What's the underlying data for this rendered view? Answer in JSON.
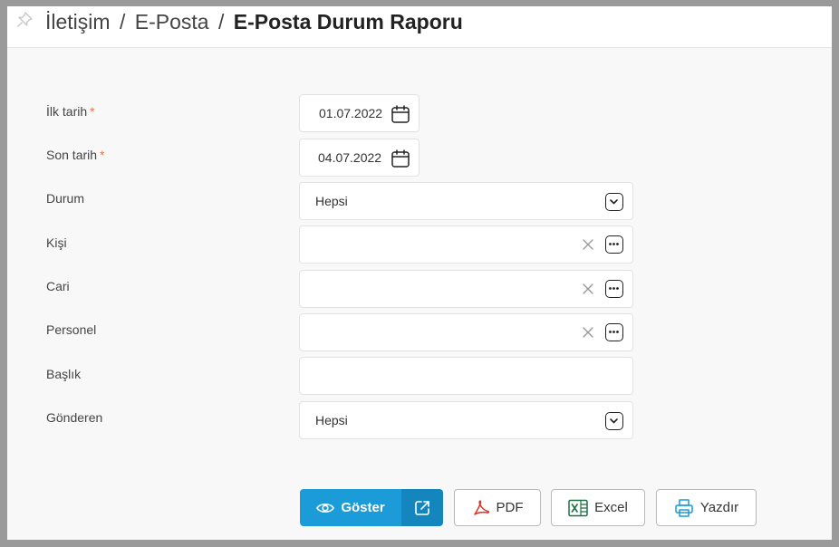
{
  "header": {
    "breadcrumb": [
      "İletişim",
      "E-Posta"
    ],
    "separator": "/",
    "title": "E-Posta Durum Raporu"
  },
  "form": {
    "required_mark": "*",
    "start_date": {
      "label": "İlk tarih",
      "value": "01.07.2022"
    },
    "end_date": {
      "label": "Son tarih",
      "value": "04.07.2022"
    },
    "status": {
      "label": "Durum",
      "value": "Hepsi"
    },
    "person": {
      "label": "Kişi",
      "value": ""
    },
    "account": {
      "label": "Cari",
      "value": ""
    },
    "staff": {
      "label": "Personel",
      "value": ""
    },
    "subject": {
      "label": "Başlık",
      "value": ""
    },
    "sender": {
      "label": "Gönderen",
      "value": "Hepsi"
    }
  },
  "actions": {
    "show": "Göster",
    "pdf": "PDF",
    "excel": "Excel",
    "print": "Yazdır"
  },
  "colors": {
    "primary": "#1b9bd7",
    "primary_dark": "#1485bd",
    "required": "#e8744f",
    "pdf_red": "#d9342b",
    "excel_green": "#1e7145",
    "print_blue": "#1b9bd7"
  }
}
